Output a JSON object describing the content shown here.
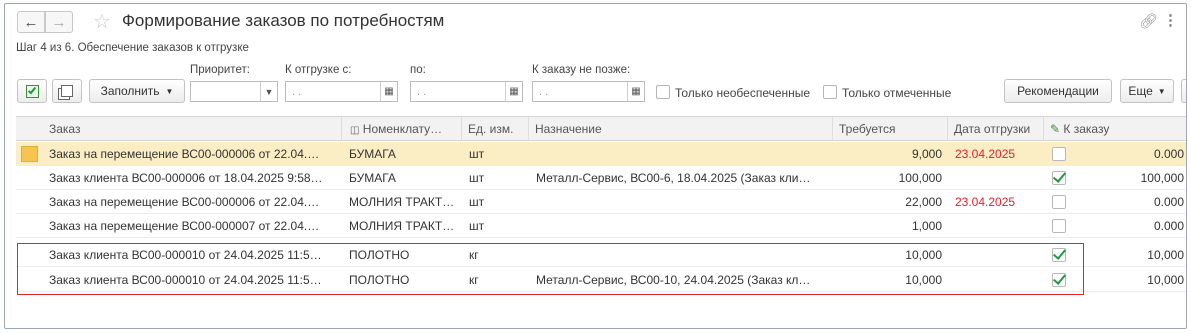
{
  "window": {
    "title": "Формирование заказов по потребностям",
    "step": "Шаг 4 из 6. Обеспечение заказов к отгрузке"
  },
  "nav": {
    "back_icon": "arrow-left",
    "forward_icon": "arrow-right",
    "favorite_icon": "star-outline",
    "link_icon": "link",
    "more_icon": "more-vertical"
  },
  "filters": {
    "priority_label": "Приоритет:",
    "ship_from_label": "К отгрузке с:",
    "ship_to_label": "по:",
    "order_by_label": "К заказу не позже:",
    "date_placeholder": ".  ."
  },
  "toolbar": {
    "fill_label": "Заполнить",
    "only_unprovided_label": "Только необеспеченные",
    "only_marked_label": "Только отмеченные",
    "recommendations_label": "Рекомендации",
    "more_label": "Еще"
  },
  "table": {
    "columns": [
      "Заказ",
      "Номенклату…",
      "Ед. изм.",
      "Назначение",
      "Требуется",
      "Дата отгрузки",
      "К заказу"
    ],
    "rows": [
      {
        "order": "Заказ на перемещение ВС00-000006 от 22.04.…",
        "item": "БУМАГА",
        "unit": "шт",
        "purpose": "",
        "required": "9,000",
        "ship_date": "23.04.2025",
        "checked": false,
        "to_order": "0.000",
        "selected": true
      },
      {
        "order": "Заказ клиента ВС00-000006 от 18.04.2025 9:58…",
        "item": "БУМАГА",
        "unit": "шт",
        "purpose": "Металл-Сервис, ВС00-6, 18.04.2025 (Заказ кли…",
        "required": "100,000",
        "ship_date": "",
        "checked": true,
        "to_order": "100,000",
        "selected": false
      },
      {
        "order": "Заказ на перемещение ВС00-000006 от 22.04.…",
        "item": "МОЛНИЯ ТРАКТ…",
        "unit": "шт",
        "purpose": "",
        "required": "22,000",
        "ship_date": "23.04.2025",
        "checked": false,
        "to_order": "0.000",
        "selected": false
      },
      {
        "order": "Заказ на перемещение ВС00-000007 от 22.04.…",
        "item": "МОЛНИЯ ТРАКТ…",
        "unit": "шт",
        "purpose": "",
        "required": "1,000",
        "ship_date": "",
        "checked": false,
        "to_order": "0.000",
        "selected": false
      },
      {
        "order": "Заказ клиента ВС00-000010 от 24.04.2025 11:5…",
        "item": "ПОЛОТНО",
        "unit": "кг",
        "purpose": "",
        "required": "10,000",
        "ship_date": "",
        "checked": true,
        "to_order": "10,000",
        "selected": false
      },
      {
        "order": "Заказ клиента ВС00-000010 от 24.04.2025 11:5…",
        "item": "ПОЛОТНО",
        "unit": "кг",
        "purpose": "Металл-Сервис, ВС00-10, 24.04.2025 (Заказ кл…",
        "required": "10,000",
        "ship_date": "",
        "checked": true,
        "to_order": "10,000",
        "selected": false
      }
    ]
  },
  "colors": {
    "accent_green": "#1d9a3c",
    "date_red": "#e0212b",
    "selected_row": "#fbedc4",
    "highlight_border": "#e0262b"
  }
}
